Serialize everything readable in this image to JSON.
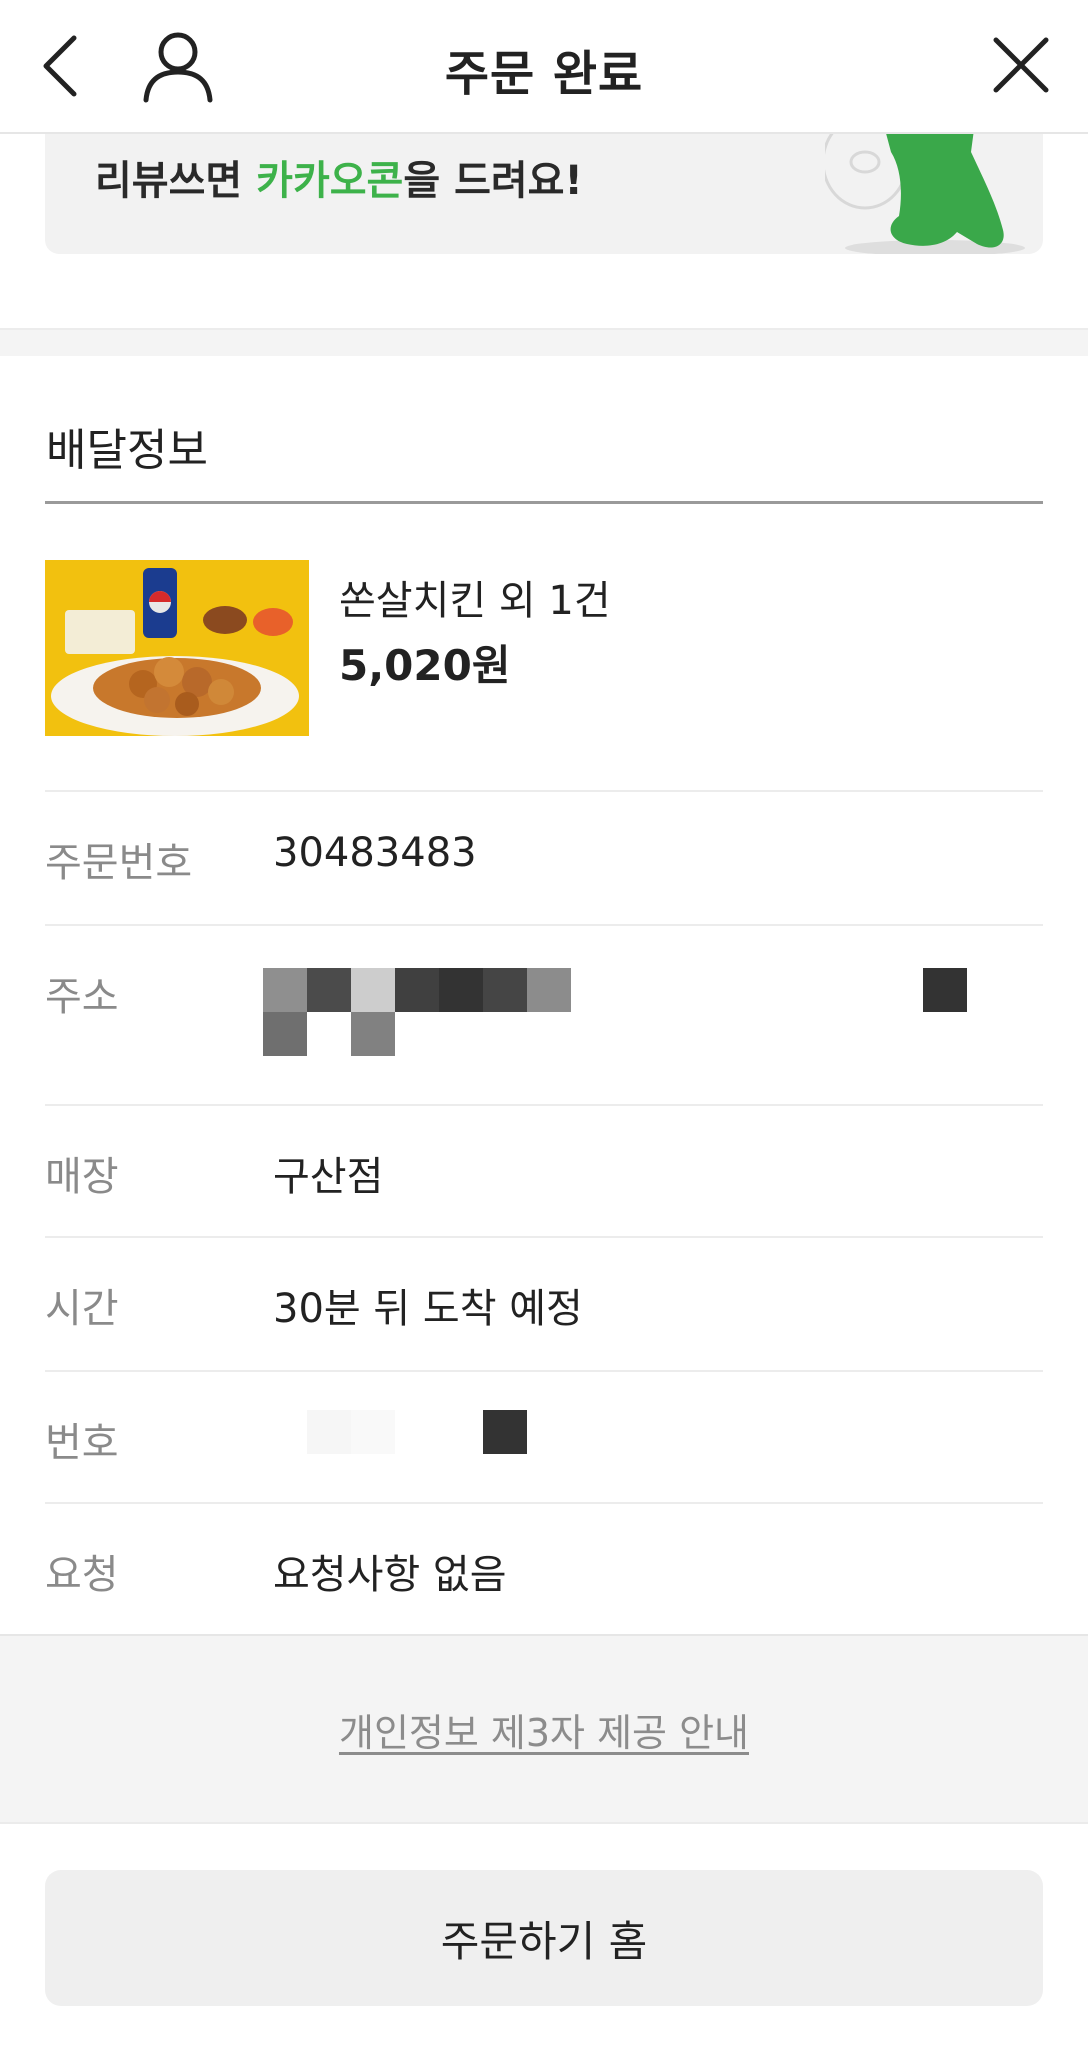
{
  "header": {
    "title": "주문 완료",
    "back_icon": "chevron-left-icon",
    "user_icon": "user-icon",
    "close_icon": "close-icon"
  },
  "banner": {
    "text_before": "리뷰쓰면 ",
    "text_highlight": "카카오콘",
    "text_after": "을 드려요!",
    "highlight_color": "#3db24a",
    "character_icon": "kakao-character-icon"
  },
  "delivery": {
    "section_title": "배달정보",
    "item": {
      "name": "쏜살치킨 외 1건",
      "price": "5,020원",
      "image": "fried-chicken-with-pepsi-photo"
    },
    "rows": [
      {
        "label": "주문번호",
        "value": "30483483"
      },
      {
        "label": "주소",
        "value": ""
      },
      {
        "label": "매장",
        "value": "구산점"
      },
      {
        "label": "시간",
        "value": "30분 뒤 도착 예정"
      },
      {
        "label": "번호",
        "value": ""
      },
      {
        "label": "요청",
        "value": "요청사항 없음"
      }
    ]
  },
  "footer": {
    "privacy_link": "개인정보 제3자 제공 안내",
    "home_button": "주문하기 홈"
  }
}
